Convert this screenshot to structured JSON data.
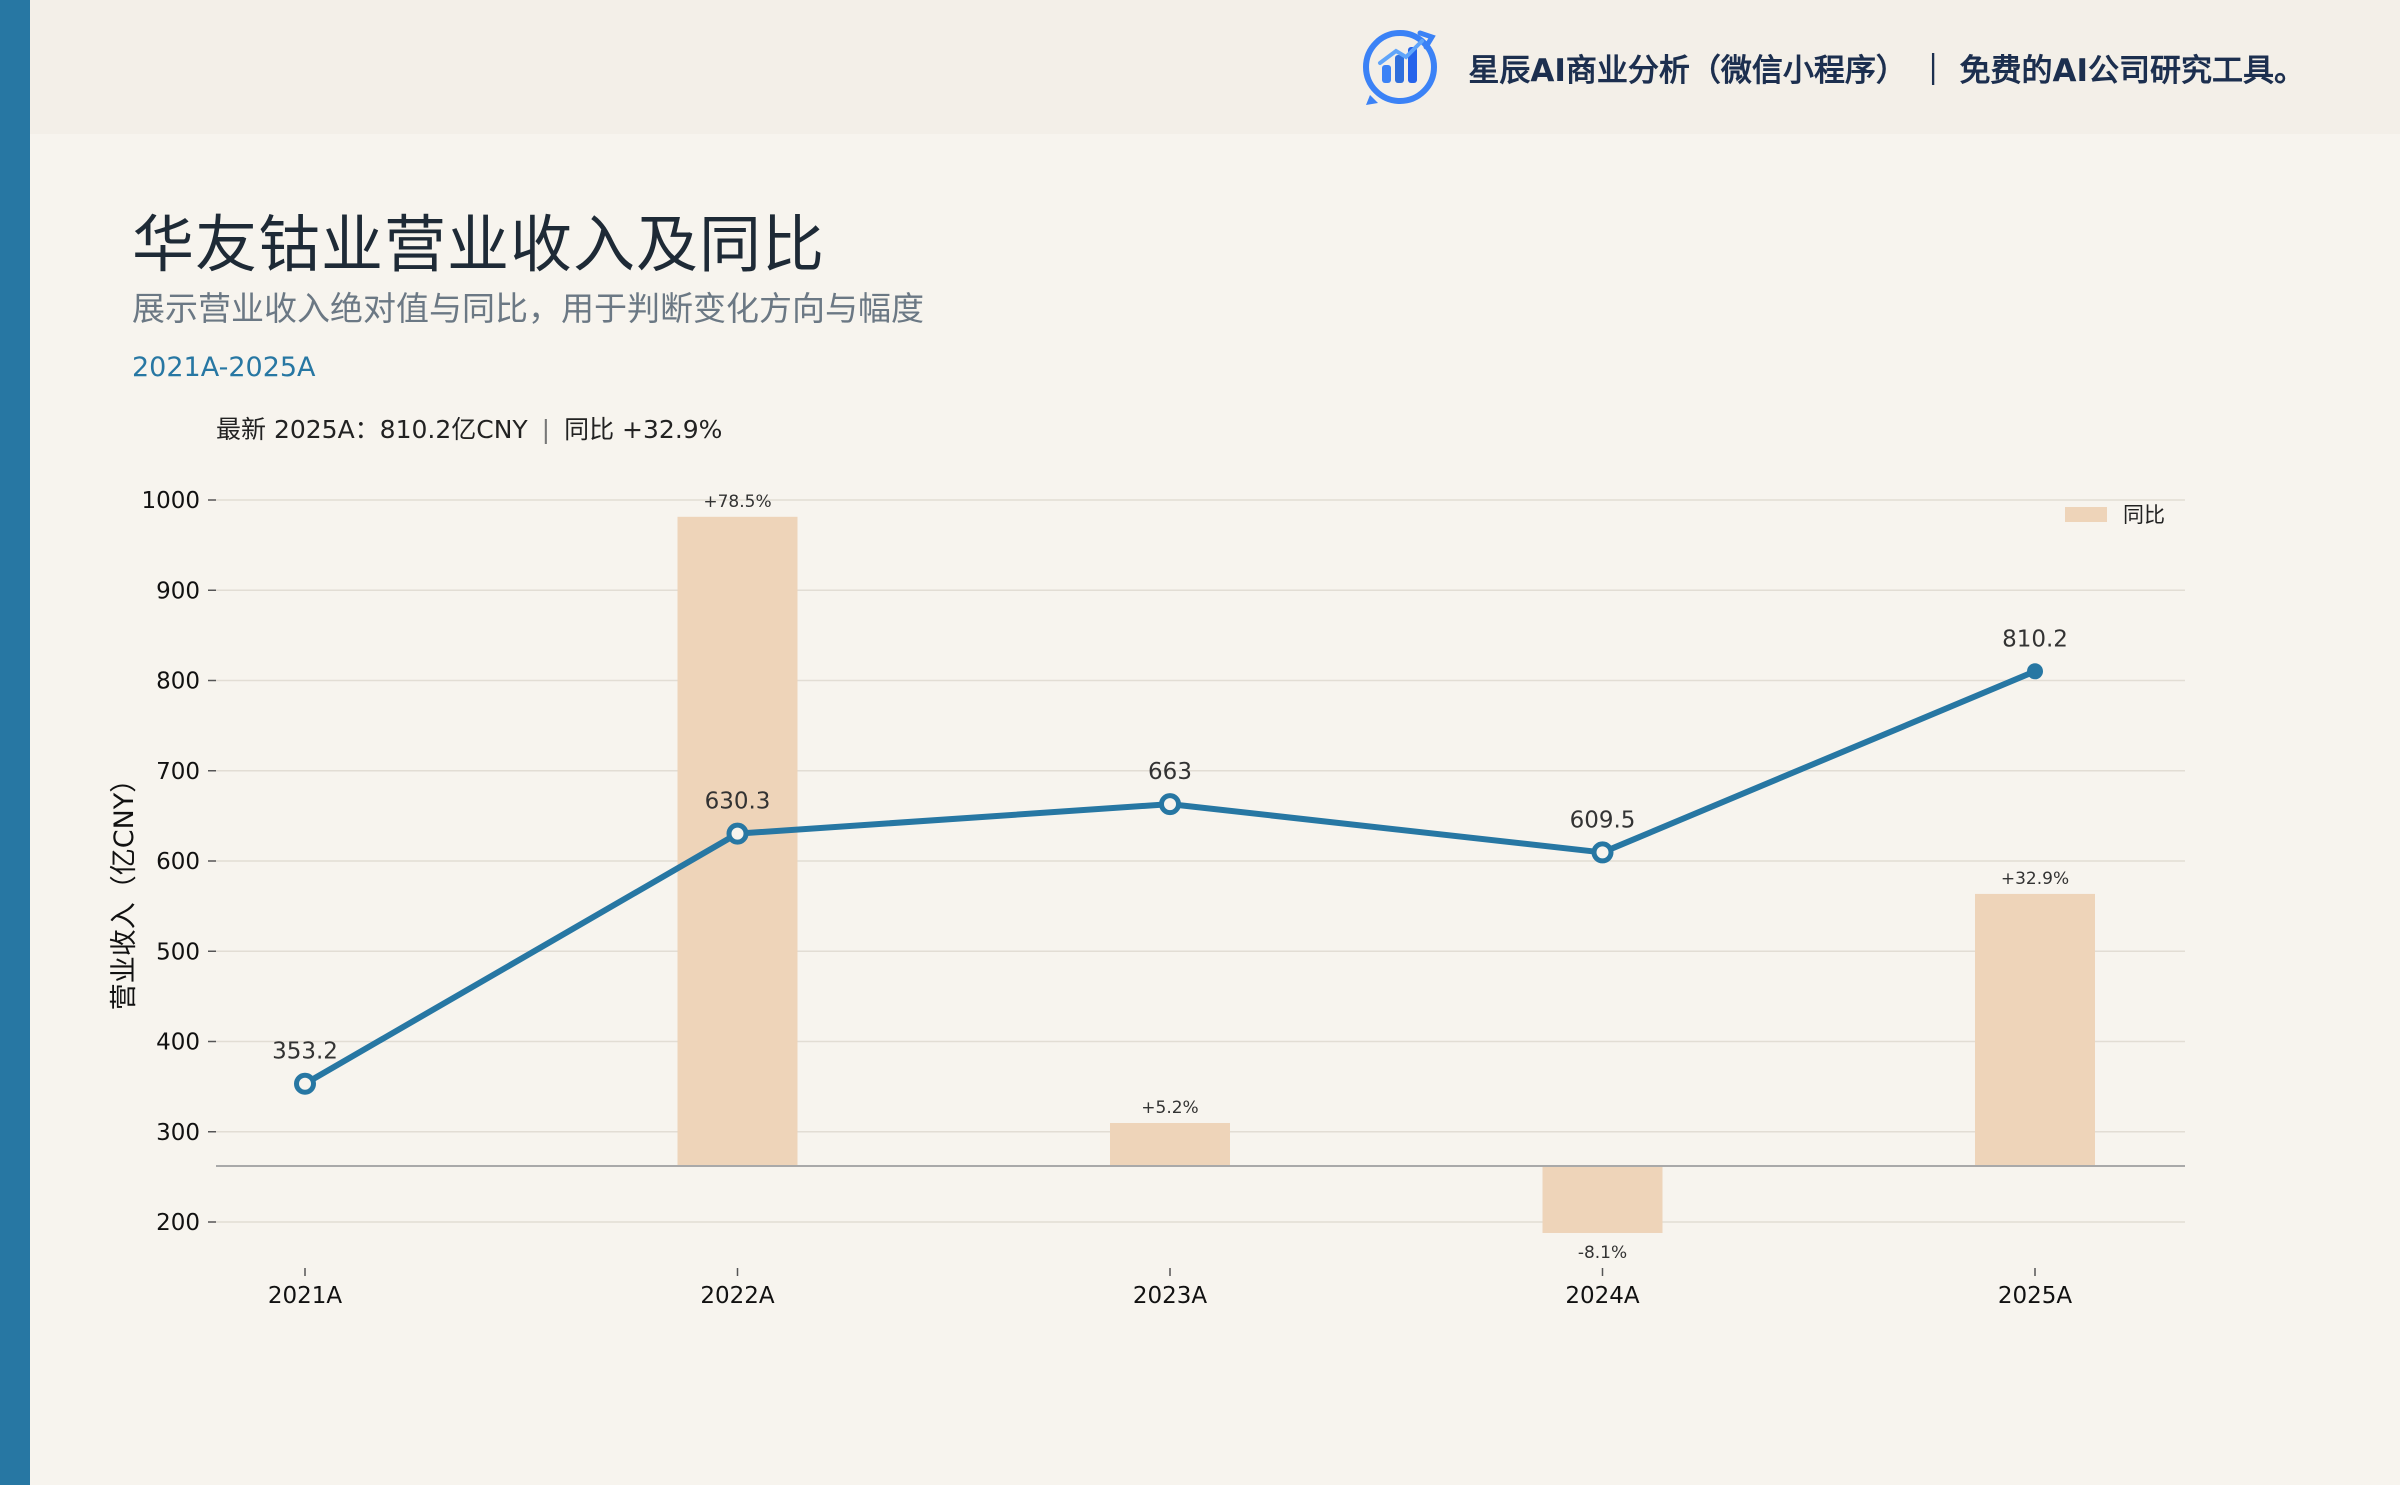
{
  "brand": {
    "text": "星辰AI商业分析（微信小程序）  ｜ 免费的AI公司研究工具。"
  },
  "title": "华友钴业营业收入及同比",
  "subtitle": "展示营业收入绝对值与同比，用于判断变化方向与幅度",
  "period": "2021A-2025A",
  "latest": {
    "left": "最新 2025A：810.2亿CNY",
    "sep": "|",
    "right": "同比 +32.9%"
  },
  "colors": {
    "accent": "#2777a3",
    "bar": "#eed4b9",
    "background": "#f7f4ee",
    "header": "#f3efe8"
  },
  "chart_data": {
    "type": "line",
    "categories": [
      "2021A",
      "2022A",
      "2023A",
      "2024A",
      "2025A"
    ],
    "ylabel": "营业收入（亿CNY）",
    "ylim": [
      160,
      1000
    ],
    "yticks": [
      200,
      300,
      400,
      500,
      600,
      700,
      800,
      900,
      1000
    ],
    "grid": true,
    "legend_position": "top-right",
    "series": [
      {
        "type": "line",
        "values": [
          353.2,
          630.3,
          663,
          609.5,
          810.2
        ],
        "labels": [
          "353.2",
          "630.3",
          "663",
          "609.5",
          "810.2"
        ],
        "color": "#2777a3"
      },
      {
        "name": "同比",
        "type": "bar",
        "axis": "secondary",
        "values": [
          null,
          78.5,
          5.2,
          -8.1,
          32.9
        ],
        "labels": [
          "",
          "+78.5%",
          "+5.2%",
          "-8.1%",
          "+32.9%"
        ],
        "color": "#eed4b9"
      }
    ]
  }
}
